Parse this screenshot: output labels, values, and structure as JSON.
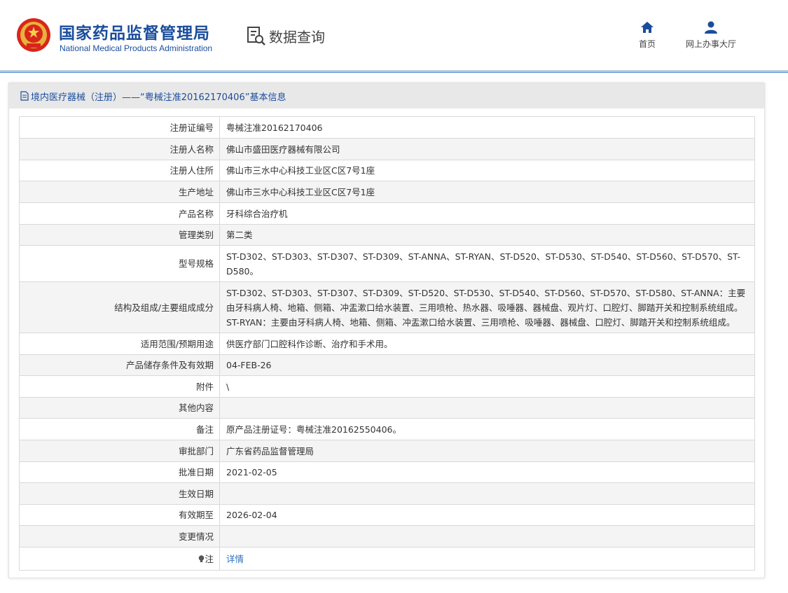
{
  "header": {
    "logo_cn": "国家药品监督管理局",
    "logo_en": "National Medical Products Administration",
    "query_label": "数据查询",
    "nav": [
      {
        "label": "首页",
        "icon": "home-icon"
      },
      {
        "label": "网上办事大厅",
        "icon": "user-icon"
      }
    ]
  },
  "panel": {
    "title": "境内医疗器械（注册）——“粤械注准20162170406”基本信息",
    "title_icon": "document-icon"
  },
  "rows": [
    {
      "label": "注册证编号",
      "value": "粤械注准20162170406"
    },
    {
      "label": "注册人名称",
      "value": "佛山市盛田医疗器械有限公司"
    },
    {
      "label": "注册人住所",
      "value": "佛山市三水中心科技工业区C区7号1座"
    },
    {
      "label": "生产地址",
      "value": "佛山市三水中心科技工业区C区7号1座"
    },
    {
      "label": "产品名称",
      "value": "牙科综合治疗机"
    },
    {
      "label": "管理类别",
      "value": "第二类"
    },
    {
      "label": "型号规格",
      "value": "ST-D302、ST-D303、ST-D307、ST-D309、ST-ANNA、ST-RYAN、ST-D520、ST-D530、ST-D540、ST-D560、ST-D570、ST-D580。"
    },
    {
      "label": "结构及组成/主要组成成分",
      "value": "ST-D302、ST-D303、ST-D307、ST-D309、ST-D520、ST-D530、ST-D540、ST-D560、ST-D570、ST-D580、ST-ANNA：主要由牙科病人椅、地箱、侧箱、冲盂漱口给水装置、三用喷枪、热水器、吸唾器、器械盘、观片灯、口腔灯、脚踏开关和控制系统组成。ST-RYAN：主要由牙科病人椅、地箱、侧箱、冲盂漱口给水装置、三用喷枪、吸唾器、器械盘、口腔灯、脚踏开关和控制系统组成。"
    },
    {
      "label": "适用范围/预期用途",
      "value": "供医疗部门口腔科作诊断、治疗和手术用。"
    },
    {
      "label": "产品储存条件及有效期",
      "value": "04-FEB-26"
    },
    {
      "label": "附件",
      "value": "\\"
    },
    {
      "label": "其他内容",
      "value": ""
    },
    {
      "label": "备注",
      "value": "原产品注册证号：粤械注准20162550406。"
    },
    {
      "label": "审批部门",
      "value": "广东省药品监督管理局"
    },
    {
      "label": "批准日期",
      "value": "2021-02-05"
    },
    {
      "label": "生效日期",
      "value": ""
    },
    {
      "label": "有效期至",
      "value": "2026-02-04"
    },
    {
      "label": "变更情况",
      "value": ""
    }
  ],
  "note_row": {
    "label": "注",
    "value": "详情",
    "icon": "bulb-icon"
  }
}
